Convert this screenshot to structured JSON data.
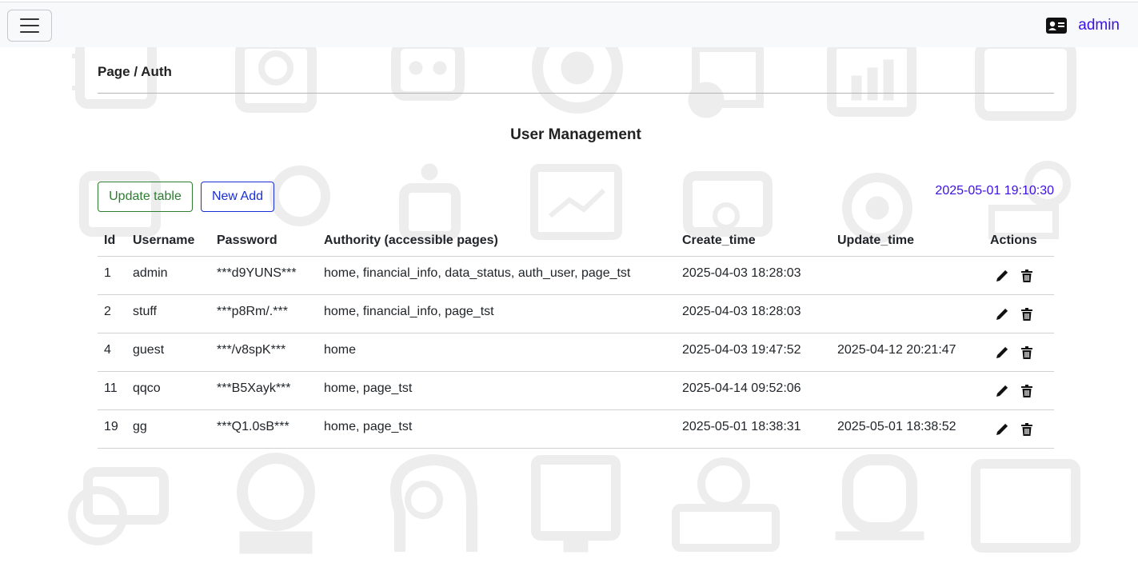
{
  "navbar": {
    "menu_icon": "hamburger-icon",
    "user_icon": "id-card-icon",
    "user_name": "admin"
  },
  "breadcrumb": "Page / Auth",
  "page_title": "User Management",
  "toolbar": {
    "update_label": "Update table",
    "add_label": "New Add",
    "timestamp": "2025-05-01 19:10:30"
  },
  "table": {
    "headers": [
      "Id",
      "Username",
      "Password",
      "Authority (accessible pages)",
      "Create_time",
      "Update_time",
      "Actions"
    ],
    "rows": [
      {
        "id": "1",
        "username": "admin",
        "password": "***d9YUNS***",
        "authority": "home, financial_info, data_status, auth_user, page_tst",
        "create_time": "2025-04-03 18:28:03",
        "update_time": ""
      },
      {
        "id": "2",
        "username": "stuff",
        "password": "***p8Rm/.***",
        "authority": "home, financial_info, page_tst",
        "create_time": "2025-04-03 18:28:03",
        "update_time": ""
      },
      {
        "id": "4",
        "username": "guest",
        "password": "***/v8spK***",
        "authority": "home",
        "create_time": "2025-04-03 19:47:52",
        "update_time": "2025-04-12 20:21:47"
      },
      {
        "id": "11",
        "username": "qqco",
        "password": "***B5Xayk***",
        "authority": "home, page_tst",
        "create_time": "2025-04-14 09:52:06",
        "update_time": ""
      },
      {
        "id": "19",
        "username": "gg",
        "password": "***Q1.0sB***",
        "authority": "home, page_tst",
        "create_time": "2025-05-01 18:38:31",
        "update_time": "2025-05-01 18:38:52"
      }
    ],
    "action_icons": [
      "pencil-icon",
      "trash-icon"
    ]
  },
  "colors": {
    "accent": "#3b0fe6",
    "update_button": "#2e7d32",
    "add_button": "#1a2fd6",
    "navbar_bg": "#f8f9fa",
    "background_icons": "#e9e9e9"
  }
}
